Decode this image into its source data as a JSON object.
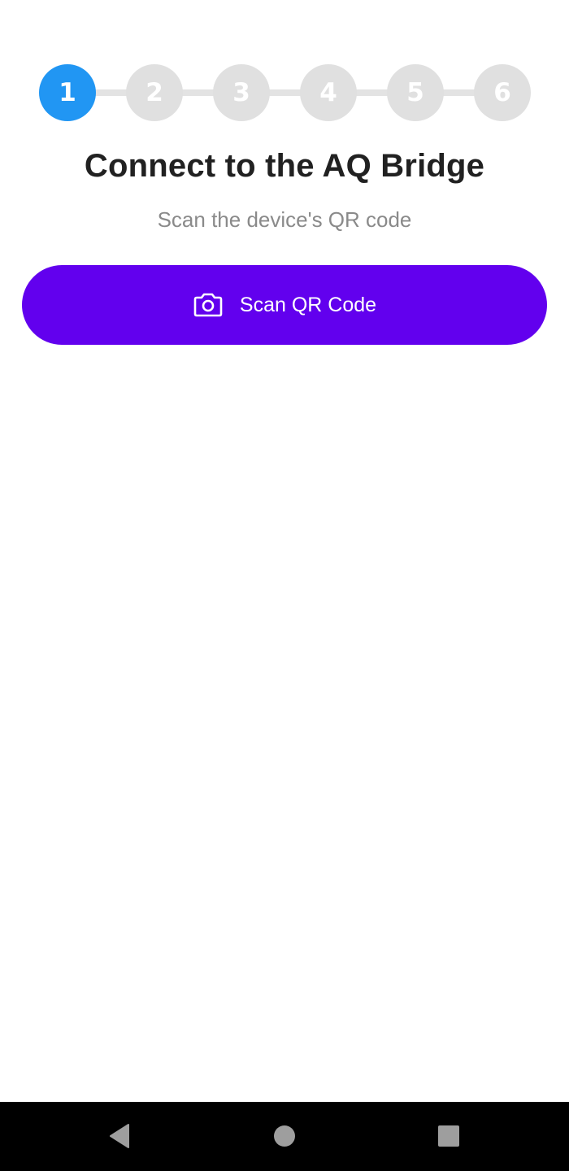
{
  "stepper": {
    "steps": [
      "1",
      "2",
      "3",
      "4",
      "5",
      "6"
    ],
    "active_index": 0,
    "active_color": "#2196f3",
    "inactive_color": "#e0e0e0"
  },
  "header": {
    "title": "Connect to the AQ Bridge",
    "subtitle": "Scan the device's QR code"
  },
  "scan_button": {
    "label": "Scan QR Code",
    "icon": "camera-icon",
    "color": "#6200ee"
  },
  "navbar": {
    "back_icon": "back-triangle-icon",
    "home_icon": "home-circle-icon",
    "recents_icon": "recents-square-icon"
  }
}
